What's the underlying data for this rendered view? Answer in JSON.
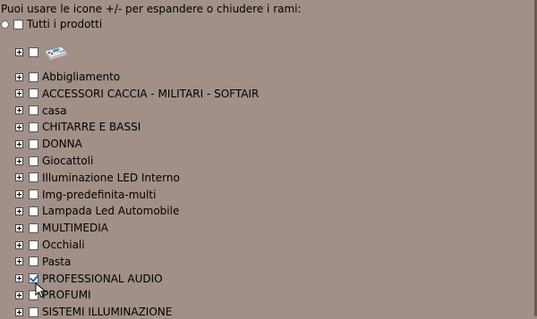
{
  "hint": "Puoi usare le icone +/- per espandere o chiudere i rami:",
  "root": {
    "label": "Tutti i prodotti",
    "checked": false
  },
  "image_item": {
    "icon": "product-thumbnail-icon",
    "checked": false
  },
  "items": [
    {
      "label": "Abbigliamento",
      "checked": false
    },
    {
      "label": "ACCESSORI CACCIA - MILITARI - SOFTAIR",
      "checked": false
    },
    {
      "label": "casa",
      "checked": false
    },
    {
      "label": "CHITARRE E BASSI",
      "checked": false
    },
    {
      "label": "DONNA",
      "checked": false
    },
    {
      "label": "Giocattoli",
      "checked": false
    },
    {
      "label": "Illuminazione LED Interno",
      "checked": false
    },
    {
      "label": "Img-predefinita-multi",
      "checked": false
    },
    {
      "label": "Lampada Led Automobile",
      "checked": false
    },
    {
      "label": "MULTIMEDIA",
      "checked": false
    },
    {
      "label": "Occhiali",
      "checked": false
    },
    {
      "label": "Pasta",
      "checked": false
    },
    {
      "label": "PROFESSIONAL AUDIO",
      "checked": true
    },
    {
      "label": "PROFUMI",
      "checked": false
    },
    {
      "label": "SISTEMI ILLUMINAZIONE",
      "checked": false
    }
  ],
  "colors": {
    "background": "#a09088",
    "check_accent": "#1565c0"
  }
}
